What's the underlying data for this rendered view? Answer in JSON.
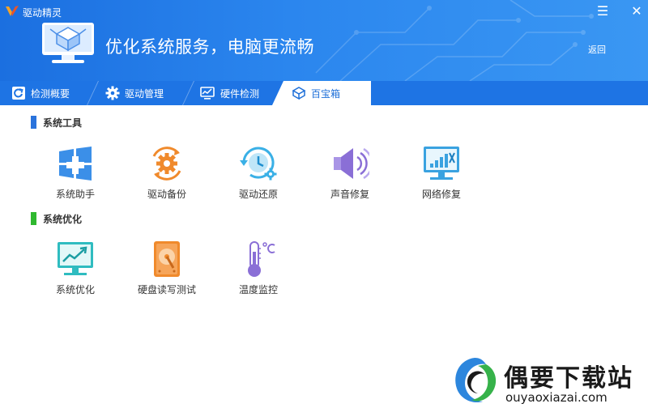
{
  "window": {
    "app_name": "驱动精灵",
    "menu_glyph": "☰",
    "close_glyph": "✕",
    "logo_icon": "driver-genius-logo-icon"
  },
  "header": {
    "title": "优化系统服务，电脑更流畅",
    "back_label": "返回",
    "hero_icon": "monitor-toolbox-icon"
  },
  "tabs": [
    {
      "label": "检测概要",
      "icon": "refresh-check-icon",
      "active": false
    },
    {
      "label": "驱动管理",
      "icon": "gear-icon",
      "active": false
    },
    {
      "label": "硬件检测",
      "icon": "monitor-chart-icon",
      "active": false
    },
    {
      "label": "百宝箱",
      "icon": "toolbox-icon",
      "active": true
    }
  ],
  "sections": [
    {
      "title": "系统工具",
      "bar_color": "#2a73dc",
      "items": [
        {
          "label": "系统助手",
          "icon": "windows-plus-icon"
        },
        {
          "label": "驱动备份",
          "icon": "gear-backup-icon"
        },
        {
          "label": "驱动还原",
          "icon": "clock-restore-icon"
        },
        {
          "label": "声音修复",
          "icon": "speaker-icon"
        },
        {
          "label": "网络修复",
          "icon": "monitor-signal-icon"
        }
      ]
    },
    {
      "title": "系统优化",
      "bar_color": "#2fb82f",
      "items": [
        {
          "label": "系统优化",
          "icon": "monitor-trend-icon"
        },
        {
          "label": "硬盘读写测试",
          "icon": "hard-disk-icon"
        },
        {
          "label": "温度监控",
          "icon": "thermometer-icon"
        }
      ]
    }
  ],
  "watermark": {
    "title": "偶要下载站",
    "url": "ouyaoxiazai.com",
    "logo_icon": "ouyao-swirl-logo-icon"
  },
  "colors": {
    "header_blue": "#2b86ee",
    "tab_bar": "#1e74e4",
    "accent_orange": "#f08a2c",
    "accent_cyan": "#3ab0e6",
    "accent_purple": "#8a6fd6"
  }
}
